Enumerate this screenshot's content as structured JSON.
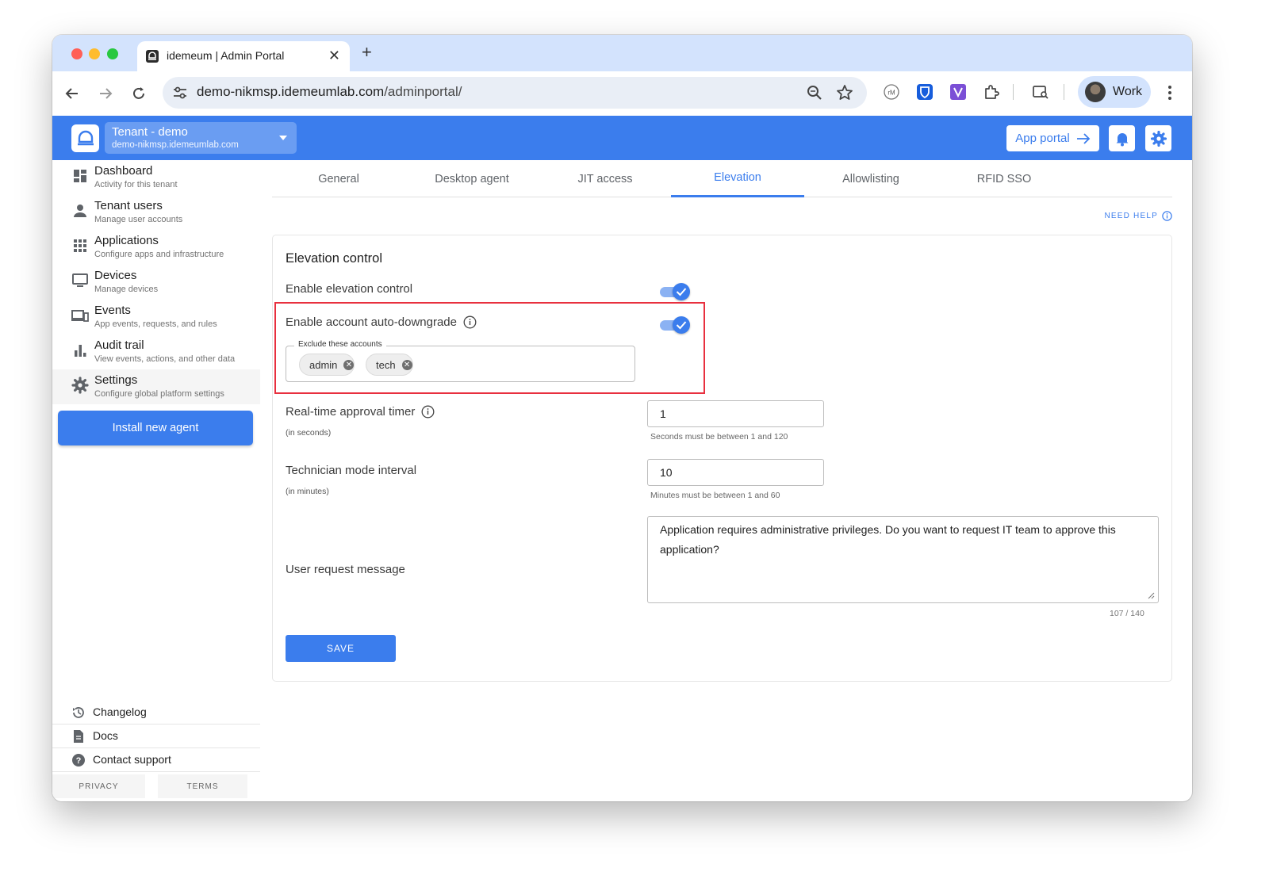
{
  "browser": {
    "tab_title": "idemeum | Admin Portal",
    "url_host": "demo-nikmsp.idemeumlab.com",
    "url_path": "/adminportal/",
    "profile_label": "Work"
  },
  "header": {
    "tenant_name": "Tenant - demo",
    "tenant_domain": "demo-nikmsp.idemeumlab.com",
    "app_portal_label": "App portal",
    "accent_color": "#3b7ded"
  },
  "sidebar": {
    "items": [
      {
        "title": "Dashboard",
        "subtitle": "Activity for this tenant",
        "icon": "dashboard-icon"
      },
      {
        "title": "Tenant users",
        "subtitle": "Manage user accounts",
        "icon": "person-icon"
      },
      {
        "title": "Applications",
        "subtitle": "Configure apps and infrastructure",
        "icon": "apps-grid-icon"
      },
      {
        "title": "Devices",
        "subtitle": "Manage devices",
        "icon": "monitor-icon"
      },
      {
        "title": "Events",
        "subtitle": "App events, requests, and rules",
        "icon": "devices-icon"
      },
      {
        "title": "Audit trail",
        "subtitle": "View events, actions, and other data",
        "icon": "bar-chart-icon"
      },
      {
        "title": "Settings",
        "subtitle": "Configure global platform settings",
        "icon": "gear-icon"
      }
    ],
    "install_label": "Install new agent",
    "footer_links": [
      "Changelog",
      "Docs",
      "Contact support"
    ],
    "privacy_label": "PRIVACY",
    "terms_label": "TERMS"
  },
  "tabs": [
    "General",
    "Desktop agent",
    "JIT access",
    "Elevation",
    "Allowlisting",
    "RFID SSO"
  ],
  "active_tab": "Elevation",
  "need_help_label": "NEED HELP",
  "form": {
    "title": "Elevation control",
    "enable_elevation_label": "Enable elevation control",
    "enable_elevation_on": true,
    "auto_downgrade_label": "Enable account auto-downgrade",
    "auto_downgrade_on": true,
    "exclude_legend": "Exclude these accounts",
    "excluded_accounts": [
      "admin",
      "tech"
    ],
    "approval_timer_label": "Real-time approval timer",
    "approval_timer_unit": "(in seconds)",
    "approval_timer_value": "1",
    "approval_timer_hint": "Seconds must be between 1 and 120",
    "technician_label": "Technician mode interval",
    "technician_unit": "(in minutes)",
    "technician_value": "10",
    "technician_hint": "Minutes must be between 1 and 60",
    "message_label": "User request message",
    "message_value": "Application requires administrative privileges. Do you want to request IT team to approve this application?",
    "message_counter": "107 / 140",
    "save_label": "SAVE"
  }
}
